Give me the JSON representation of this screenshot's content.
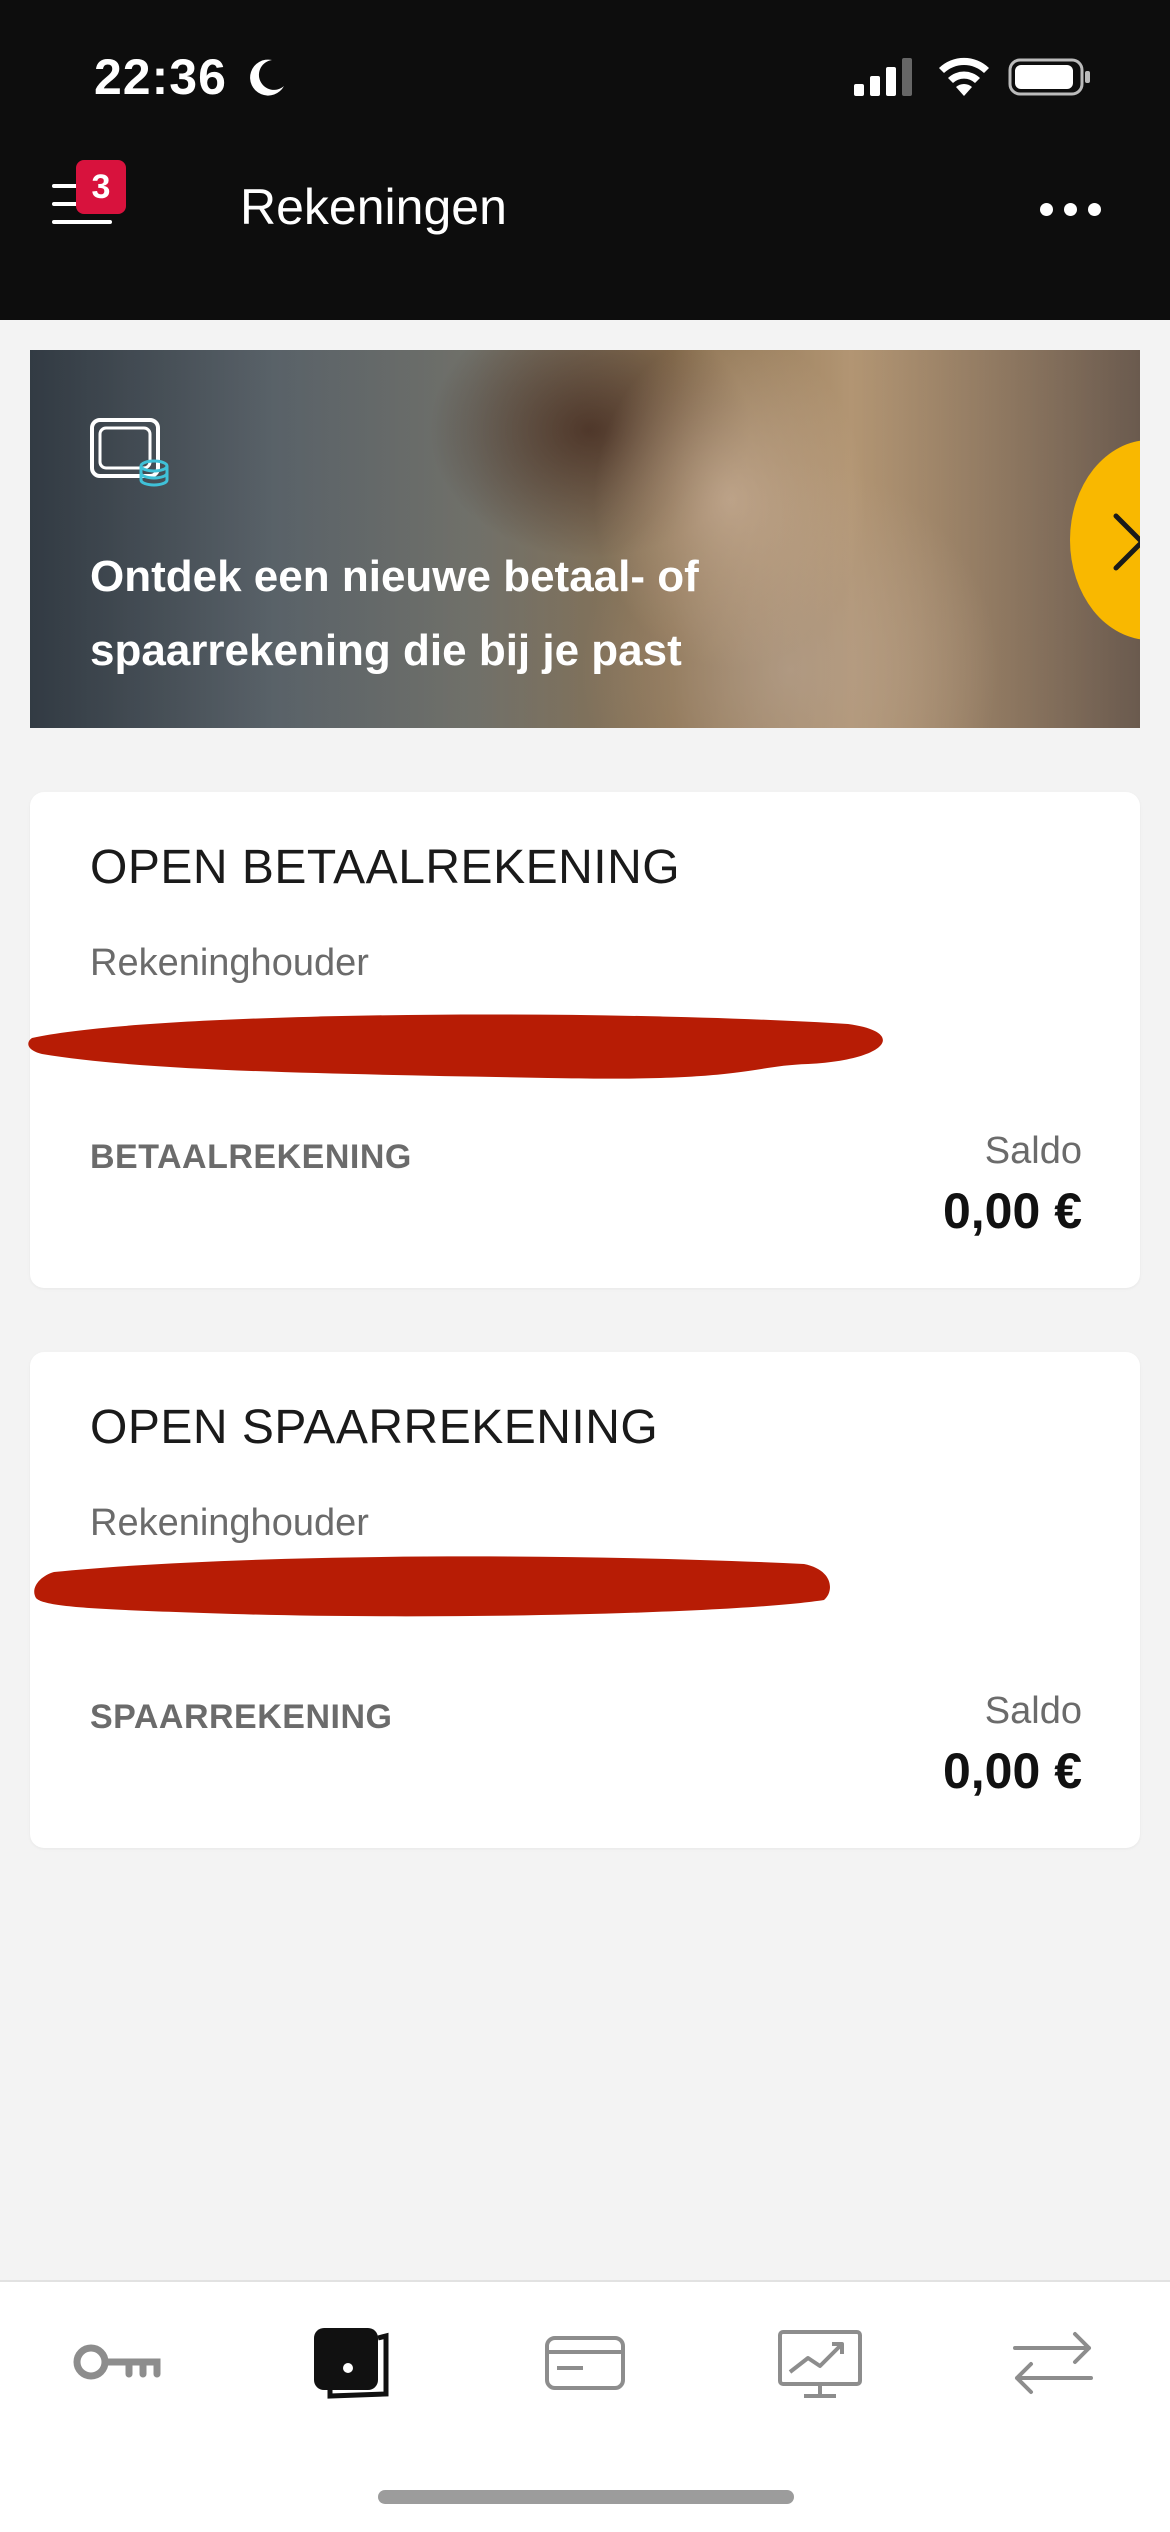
{
  "status_bar": {
    "time": "22:36"
  },
  "header": {
    "title": "Rekeningen",
    "badge_count": "3"
  },
  "banner": {
    "text": "Ontdek een nieuwe betaal- of spaarrekening die bij je past"
  },
  "accounts": [
    {
      "title": "OPEN BETAALREKENING",
      "holder_label": "Rekeninghouder",
      "type": "BETAALREKENING",
      "saldo_label": "Saldo",
      "saldo": "0,00 €"
    },
    {
      "title": "OPEN SPAARREKENING",
      "holder_label": "Rekeninghouder",
      "type": "SPAARREKENING",
      "saldo_label": "Saldo",
      "saldo": "0,00 €"
    }
  ],
  "bottom_nav": [
    "key-icon",
    "wallet-icon",
    "card-icon",
    "investments-icon",
    "transfer-icon"
  ],
  "colors": {
    "accent_yellow": "#f9b800",
    "badge_red": "#d8123d",
    "redaction": "#b71c05"
  }
}
